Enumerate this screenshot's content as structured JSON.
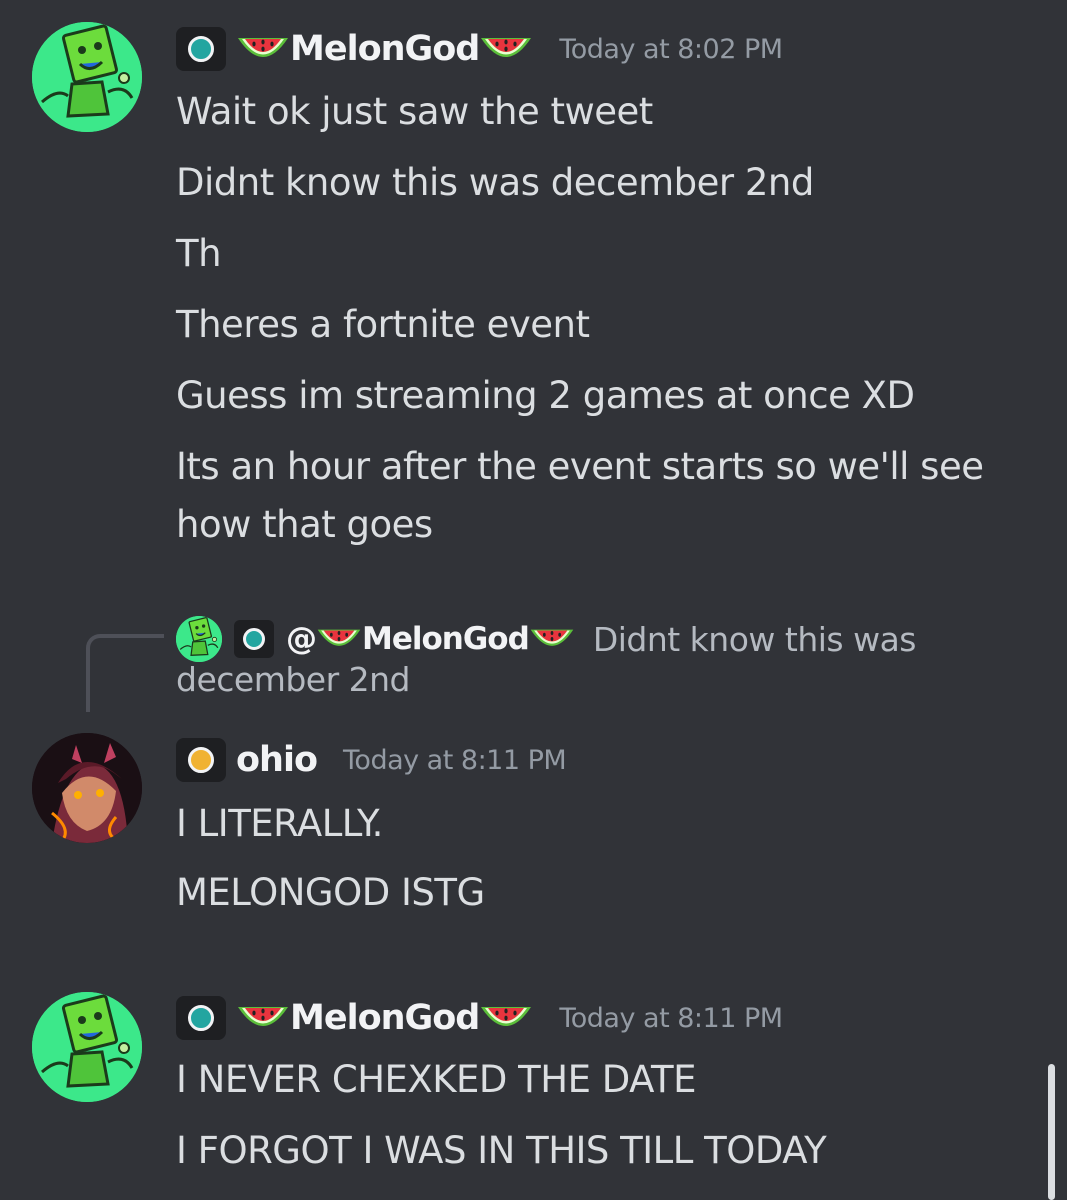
{
  "colors": {
    "background": "#313338",
    "teal_status": "#23a5a0",
    "yellow_status": "#f0b232",
    "melon_avatar": "#3ce88a"
  },
  "messages": [
    {
      "username": "MelonGod",
      "timestamp": "Today at 8:02 PM",
      "avatar_icon": "green-robot-avatar",
      "lines": [
        "Wait ok just saw the tweet",
        "Didnt know this was december 2nd",
        "Th",
        "Theres a fortnite event",
        "Guess im streaming 2 games at once XD",
        "Its an hour after the event starts so we'll see",
        "how that goes"
      ]
    },
    {
      "username": "ohio",
      "timestamp": "Today at 8:11 PM",
      "avatar_icon": "dark-character-avatar",
      "lines": [
        "I LITERALLY.",
        "MELONGOD ISTG"
      ]
    },
    {
      "username": "MelonGod",
      "timestamp": "Today at 8:11 PM",
      "avatar_icon": "green-robot-avatar",
      "lines": [
        "I NEVER CHEXKED THE DATE",
        "I FORGOT I WAS IN THIS TILL TODAY"
      ]
    }
  ],
  "reply": {
    "mention": "@",
    "username": "MelonGod",
    "preview": "Didnt know this was",
    "preview_cont": "december 2nd"
  }
}
